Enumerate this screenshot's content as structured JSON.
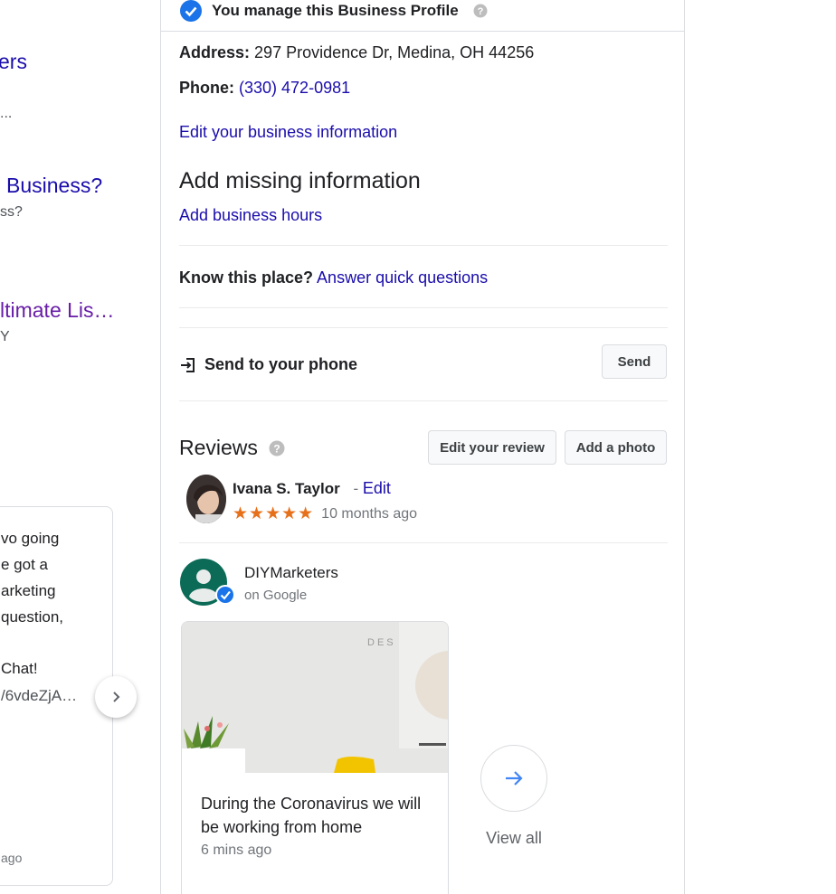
{
  "left_results": {
    "result1_title_fragment": "ers",
    "result1_snippet_fragment": "...",
    "result2_title_fragment": "Business?",
    "result2_snippet_fragment": "ss?",
    "result3_title_fragment": "ltimate Lis…",
    "result3_snippet_fragment": "Y",
    "post_lines": [
      "vo going",
      "e got a",
      "arketing",
      "question,",
      "",
      "Chat!"
    ],
    "post_url_fragment": "/6vdeZjA…",
    "post_time_fragment": "ago"
  },
  "panel": {
    "manage_text": "You manage this Business Profile",
    "address_label": "Address:",
    "address_value": "297 Providence Dr, Medina, OH 44256",
    "phone_label": "Phone:",
    "phone_value": "(330) 472-0981",
    "edit_info_link": "Edit your business information",
    "missing_heading": "Add missing information",
    "add_hours_link": "Add business hours",
    "know_place_label": "Know this place?",
    "answer_link": "Answer quick questions",
    "send_label": "Send to your phone",
    "send_button": "Send",
    "reviews_heading": "Reviews",
    "edit_review_button": "Edit your review",
    "add_photo_button": "Add a photo",
    "review": {
      "author": "Ivana S. Taylor",
      "separator": "-",
      "edit_link": "Edit",
      "stars": "★★★★★",
      "rating": 5,
      "time": "10 months ago"
    },
    "post": {
      "business_name": "DIYMarketers",
      "source": "on Google",
      "text": "During the Coronavirus we will be working from home",
      "time": "6 mins ago",
      "view_all": "View all"
    }
  },
  "colors": {
    "link": "#1a0dab",
    "visited_link": "#681da8",
    "star": "#e7711b",
    "verified_badge": "#1a73e8",
    "business_avatar": "#0b6b57",
    "arrow_accent": "#4285f4"
  }
}
